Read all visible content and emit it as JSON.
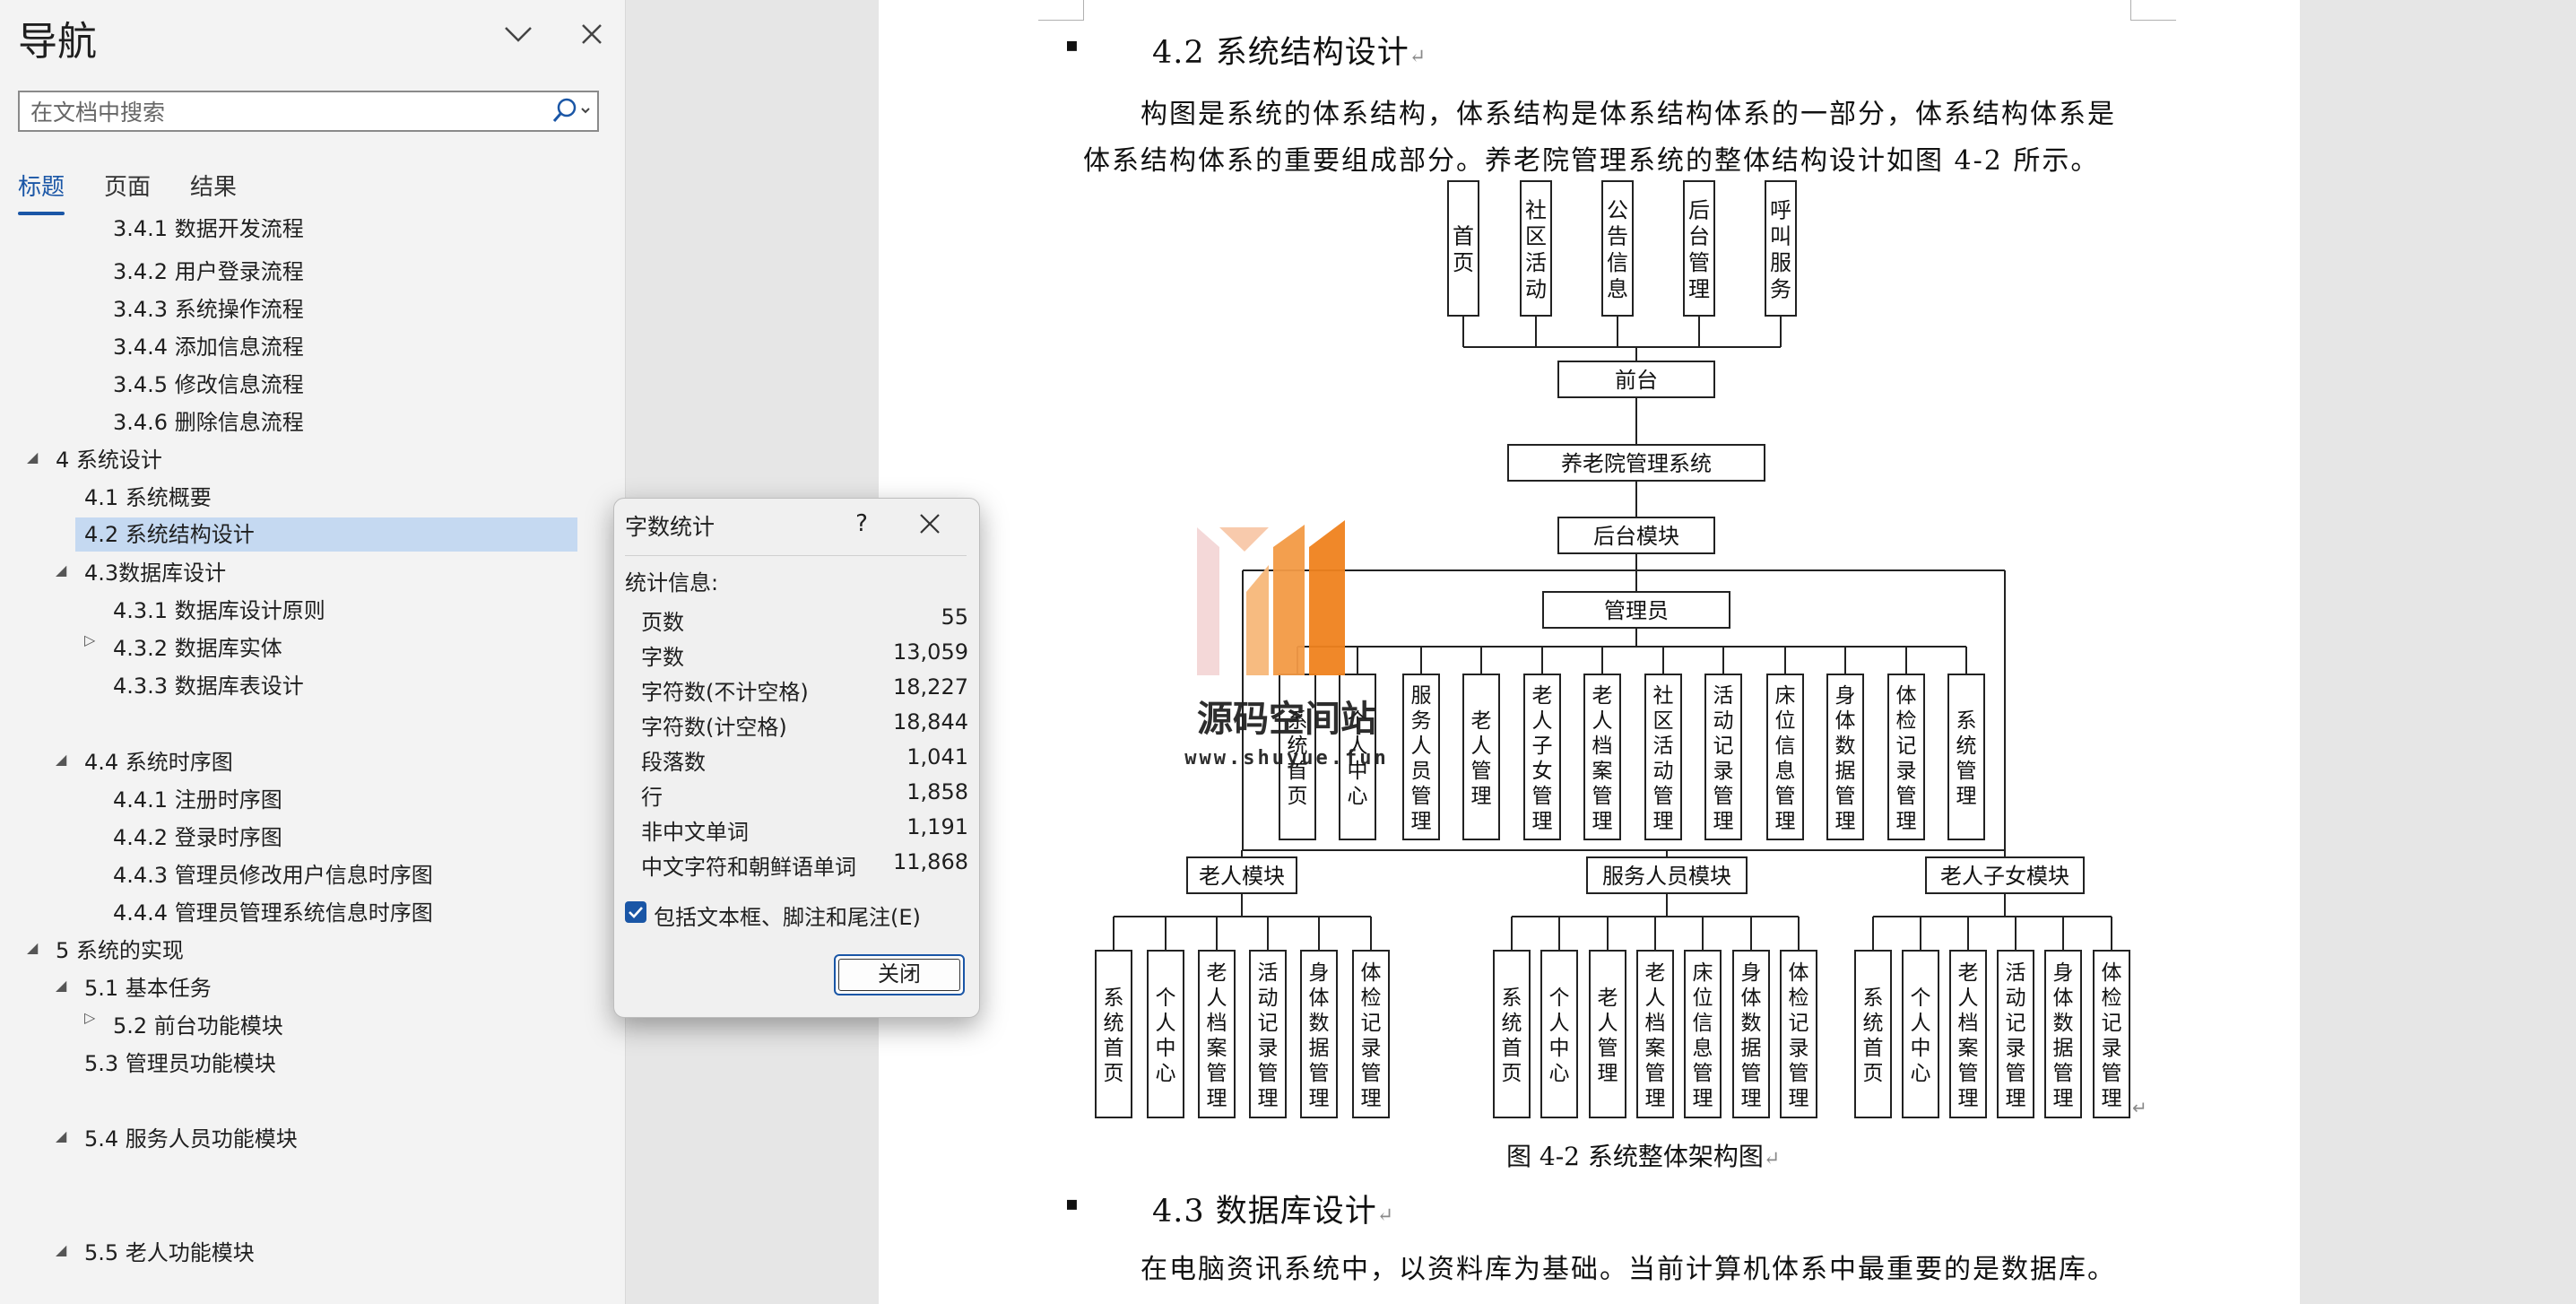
{
  "nav": {
    "title": "导航",
    "search_placeholder": "在文档中搜索",
    "tabs": [
      "标题",
      "页面",
      "结果"
    ],
    "items": [
      {
        "label": "3.4.1 数据开发流程"
      },
      {
        "label": "3.4.2 用户登录流程"
      },
      {
        "label": "3.4.3 系统操作流程"
      },
      {
        "label": "3.4.4 添加信息流程"
      },
      {
        "label": "3.4.5 修改信息流程"
      },
      {
        "label": "3.4.6 删除信息流程"
      },
      {
        "label": "4 系统设计"
      },
      {
        "label": "4.1 系统概要"
      },
      {
        "label": "4.2 系统结构设计"
      },
      {
        "label": "4.3数据库设计"
      },
      {
        "label": "4.3.1 数据库设计原则"
      },
      {
        "label": "4.3.2 数据库实体"
      },
      {
        "label": "4.3.3 数据库表设计"
      },
      {
        "label": "4.4 系统时序图"
      },
      {
        "label": "4.4.1 注册时序图"
      },
      {
        "label": "4.4.2 登录时序图"
      },
      {
        "label": "4.4.3 管理员修改用户信息时序图"
      },
      {
        "label": "4.4.4 管理员管理系统信息时序图"
      },
      {
        "label": "5 系统的实现"
      },
      {
        "label": "5.1 基本任务"
      },
      {
        "label": "5.2 前台功能模块"
      },
      {
        "label": "5.3 管理员功能模块"
      },
      {
        "label": "5.4 服务人员功能模块"
      },
      {
        "label": "5.5 老人功能模块"
      }
    ]
  },
  "document": {
    "heading1": "4.2  系统结构设计",
    "para1_line1": "构图是系统的体系结构，体系结构是体系结构体系的一部分，体系结构体系是",
    "para1_line2": "体系结构体系的重要组成部分。养老院管理系统的整体结构设计如图 4-2 所示。",
    "caption": "图 4-2  系统整体架构图",
    "heading2": "4.3 数据库设计",
    "para2": "在电脑资讯系统中，以资料库为基础。当前计算机体系中最重要的是数据库。",
    "diagram": {
      "front_items": [
        "首页",
        "社区活动",
        "公告信息",
        "后台管理",
        "呼叫服务"
      ],
      "front": "前台",
      "system": "养老院管理系统",
      "backend": "后台模块",
      "admin": "管理员",
      "admin_items": [
        "系统首页",
        "个人中心",
        "服务人员管理",
        "老人管理",
        "老人子女管理",
        "老人档案管理",
        "社区活动管理",
        "活动记录管理",
        "床位信息管理",
        "身体数据管理",
        "体检记录管理",
        "系统管理"
      ],
      "modules": [
        {
          "name": "老人模块",
          "items": [
            "系统首页",
            "个人中心",
            "老人档案管理",
            "活动记录管理",
            "身体数据管理",
            "体检记录管理"
          ]
        },
        {
          "name": "服务人员模块",
          "items": [
            "系统首页",
            "个人中心",
            "老人管理",
            "老人档案管理",
            "床位信息管理",
            "身体数据管理",
            "体检记录管理"
          ]
        },
        {
          "name": "老人子女模块",
          "items": [
            "系统首页",
            "个人中心",
            "老人档案管理",
            "活动记录管理",
            "身体数据管理",
            "体检记录管理"
          ]
        }
      ]
    },
    "watermark": {
      "name": "源码空间站",
      "url": "www.shuyue.fun"
    }
  },
  "dialog": {
    "title": "字数统计",
    "help": "?",
    "stats_label": "统计信息:",
    "stats": [
      {
        "name": "页数",
        "value": "55"
      },
      {
        "name": "字数",
        "value": "13,059"
      },
      {
        "name": "字符数(不计空格)",
        "value": "18,227"
      },
      {
        "name": "字符数(计空格)",
        "value": "18,844"
      },
      {
        "name": "段落数",
        "value": "1,041"
      },
      {
        "name": "行",
        "value": "1,858"
      },
      {
        "name": "非中文单词",
        "value": "1,191"
      },
      {
        "name": "中文字符和朝鲜语单词",
        "value": "11,868"
      }
    ],
    "include_label": "包括文本框、脚注和尾注(E)",
    "close_label": "关闭"
  },
  "colors": {
    "accent": "#1a56a6",
    "selected": "#c5d9f1",
    "watermark_orange": "#f0821e"
  }
}
